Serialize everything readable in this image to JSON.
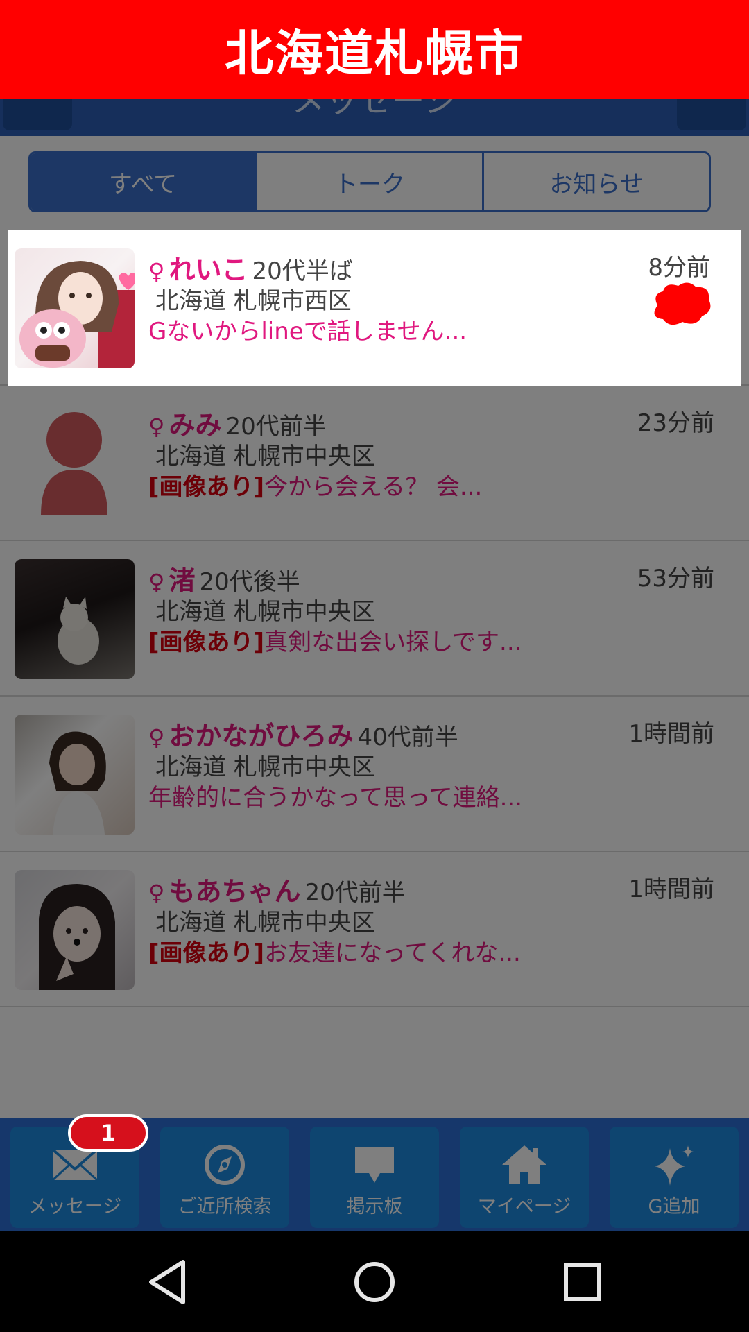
{
  "banner": {
    "title": "北海道札幌市"
  },
  "header": {
    "title": "メッセージ"
  },
  "tabs": [
    {
      "label": "すべて",
      "active": true
    },
    {
      "label": "トーク",
      "active": false
    },
    {
      "label": "お知らせ",
      "active": false
    }
  ],
  "messages": [
    {
      "gender": "♀",
      "name": "れいこ",
      "age": "20代半ば",
      "location": "北海道 札幌市西区",
      "image_tag": "",
      "preview": "Gないからlineで話しません...",
      "time": "8分前",
      "highlighted": true
    },
    {
      "gender": "♀",
      "name": "みみ",
      "age": "20代前半",
      "location": "北海道 札幌市中央区",
      "image_tag": "[画像あり]",
      "preview": "今から会える？ 会...",
      "time": "23分前"
    },
    {
      "gender": "♀",
      "name": "渚",
      "age": "20代後半",
      "location": "北海道 札幌市中央区",
      "image_tag": "[画像あり]",
      "preview": "真剣な出会い探しです...",
      "time": "53分前"
    },
    {
      "gender": "♀",
      "name": "おかながひろみ",
      "age": "40代前半",
      "location": "北海道 札幌市中央区",
      "image_tag": "",
      "preview": "年齢的に合うかなって思って連絡...",
      "time": "1時間前"
    },
    {
      "gender": "♀",
      "name": "もあちゃん",
      "age": "20代前半",
      "location": "北海道 札幌市中央区",
      "image_tag": "[画像あり]",
      "preview": "お友達になってくれな...",
      "time": "1時間前"
    }
  ],
  "bottom_nav": {
    "items": [
      {
        "label": "メッセージ",
        "icon": "envelope-icon"
      },
      {
        "label": "ご近所検索",
        "icon": "compass-icon"
      },
      {
        "label": "掲示板",
        "icon": "speech-bubble-icon"
      },
      {
        "label": "マイページ",
        "icon": "home-icon"
      },
      {
        "label": "G追加",
        "icon": "sparkle-icon"
      }
    ],
    "badge_count": "1"
  },
  "colors": {
    "banner": "#ff0000",
    "primary": "#2c5fb6",
    "accent": "#e0187f",
    "badge": "#d6101c"
  }
}
